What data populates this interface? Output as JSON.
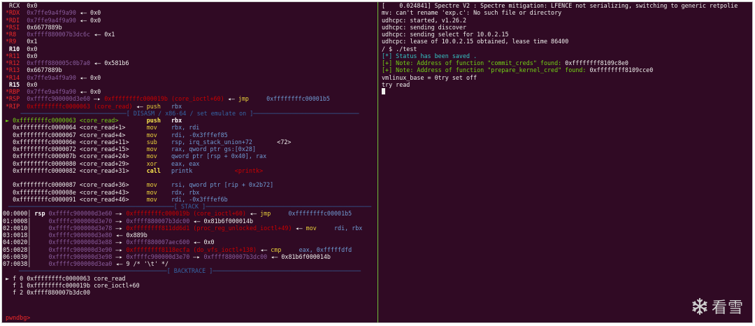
{
  "registers": [
    {
      "name": "RCX",
      "name_color": "w",
      "segs": [
        {
          "t": "0x0",
          "c": "w"
        }
      ]
    },
    {
      "name": "*RDX",
      "name_color": "r",
      "segs": [
        {
          "t": "0x7ffe9a4f9a90",
          "c": "m"
        },
        {
          "t": " ◂— ",
          "c": "w"
        },
        {
          "t": "0x0",
          "c": "w"
        }
      ]
    },
    {
      "name": "*RDI",
      "name_color": "r",
      "segs": [
        {
          "t": "0x7ffe9a4f9a90",
          "c": "m"
        },
        {
          "t": " ◂— ",
          "c": "w"
        },
        {
          "t": "0x0",
          "c": "w"
        }
      ]
    },
    {
      "name": "*RSI",
      "name_color": "r",
      "segs": [
        {
          "t": "0x6677889b",
          "c": "w"
        }
      ]
    },
    {
      "name": "*R8",
      "name_color": "r",
      "segs": [
        {
          "t": "0xffff880007b3dc6c",
          "c": "m"
        },
        {
          "t": " ◂— ",
          "c": "w"
        },
        {
          "t": "0x1",
          "c": "w"
        }
      ]
    },
    {
      "name": "*R9",
      "name_color": "r",
      "segs": [
        {
          "t": "0x1",
          "c": "w"
        }
      ]
    },
    {
      "name": "R10",
      "name_color": "b",
      "segs": [
        {
          "t": "0x0",
          "c": "w"
        }
      ]
    },
    {
      "name": "*R11",
      "name_color": "r",
      "segs": [
        {
          "t": "0x0",
          "c": "w"
        }
      ]
    },
    {
      "name": "*R12",
      "name_color": "r",
      "segs": [
        {
          "t": "0xffff880005c0b7a0",
          "c": "m"
        },
        {
          "t": " ◂— ",
          "c": "w"
        },
        {
          "t": "0x581b6",
          "c": "w"
        }
      ]
    },
    {
      "name": "*R13",
      "name_color": "r",
      "segs": [
        {
          "t": "0x6677889b",
          "c": "w"
        }
      ]
    },
    {
      "name": "*R14",
      "name_color": "r",
      "segs": [
        {
          "t": "0x7ffe9a4f9a90",
          "c": "m"
        },
        {
          "t": " ◂— ",
          "c": "w"
        },
        {
          "t": "0x0",
          "c": "w"
        }
      ]
    },
    {
      "name": "R15",
      "name_color": "b",
      "segs": [
        {
          "t": "0x0",
          "c": "w"
        }
      ]
    },
    {
      "name": "*RBP",
      "name_color": "r",
      "segs": [
        {
          "t": "0x7ffe9a4f9a90",
          "c": "m"
        },
        {
          "t": " ◂— ",
          "c": "w"
        },
        {
          "t": "0x0",
          "c": "w"
        }
      ]
    },
    {
      "name": "*RSP",
      "name_color": "r",
      "segs": [
        {
          "t": "0xffffc900000d3e60",
          "c": "m"
        },
        {
          "t": " —▸ ",
          "c": "w"
        },
        {
          "t": "0xffffffffc000019b (core_ioctl+60)",
          "c": "rd"
        },
        {
          "t": " ◂— ",
          "c": "w"
        },
        {
          "t": "jmp",
          "c": "yn"
        },
        {
          "t": "     ",
          "c": "w"
        },
        {
          "t": "0xffffffffc00001b5",
          "c": "bd"
        }
      ]
    },
    {
      "name": "*RIP",
      "name_color": "r",
      "segs": [
        {
          "t": "0xffffffffc0000063 (core_read)",
          "c": "rd"
        },
        {
          "t": " ◂— ",
          "c": "w"
        },
        {
          "t": "push",
          "c": "yn"
        },
        {
          "t": "   rbx",
          "c": "bl"
        }
      ]
    }
  ],
  "disasm_banner": "[ DISASM / x86-64 / set emulate on ]",
  "disasm": [
    {
      "cur": true,
      "addr": "0xffffffffc0000063 <core_read>",
      "mn": "push",
      "op": "rbx",
      "hl": true
    },
    {
      "addr": "0xffffffffc0000064 <core_read+1>",
      "mn": "mov",
      "op": "rbx, rdi"
    },
    {
      "addr": "0xffffffffc0000067 <core_read+4>",
      "mn": "mov",
      "op": "rdi, -0x3fffef85"
    },
    {
      "addr": "0xffffffffc000006e <core_read+11>",
      "mn": "sub",
      "op": "rsp, irq_stack_union+72",
      "extra": "<72>"
    },
    {
      "addr": "0xffffffffc0000072 <core_read+15>",
      "mn": "mov",
      "op": "rax, qword ptr gs:[0x28]"
    },
    {
      "addr": "0xffffffffc000007b <core_read+24>",
      "mn": "mov",
      "op": "qword ptr [rsp + 0x40], rax"
    },
    {
      "addr": "0xffffffffc0000080 <core_read+29>",
      "mn": "xor",
      "op": "eax, eax"
    },
    {
      "addr": "0xffffffffc0000082 <core_read+31>",
      "mn": "call",
      "op": "printk",
      "extra": "<printk>",
      "call": true
    },
    {
      "blank": true
    },
    {
      "addr": "0xffffffffc0000087 <core_read+36>",
      "mn": "mov",
      "op": "rsi, qword ptr [rip + 0x2b72]"
    },
    {
      "addr": "0xffffffffc000008e <core_read+43>",
      "mn": "mov",
      "op": "rdx, rbx"
    },
    {
      "addr": "0xffffffffc0000091 <core_read+46>",
      "mn": "mov",
      "op": "rdi, -0x3fffef6b"
    }
  ],
  "stack_banner": "[ STACK ]",
  "stack": [
    {
      "idx": "00:0000",
      "lbl": "rsp",
      "segs": [
        {
          "t": "0xffffc900000d3e60",
          "c": "m"
        },
        {
          "t": " —▸ ",
          "c": "w"
        },
        {
          "t": "0xffffffffc000019b (core_ioctl+60)",
          "c": "rd"
        },
        {
          "t": " ◂— ",
          "c": "w"
        },
        {
          "t": "jmp",
          "c": "yn"
        },
        {
          "t": "     0xffffffffc00001b5",
          "c": "bd"
        }
      ]
    },
    {
      "idx": "01:0008",
      "lbl": "",
      "segs": [
        {
          "t": "0xffffc900000d3e70",
          "c": "m"
        },
        {
          "t": " —▸ ",
          "c": "w"
        },
        {
          "t": "0xffff880007b3dc00",
          "c": "m"
        },
        {
          "t": " ◂— ",
          "c": "w"
        },
        {
          "t": "0x81b6f000014b",
          "c": "w"
        }
      ]
    },
    {
      "idx": "02:0010",
      "lbl": "",
      "segs": [
        {
          "t": "0xffffc900000d3e78",
          "c": "m"
        },
        {
          "t": " —▸ ",
          "c": "w"
        },
        {
          "t": "0xffffffff811dd6d1 (proc_reg_unlocked_ioctl+49)",
          "c": "rd"
        },
        {
          "t": " ◂— ",
          "c": "w"
        },
        {
          "t": "mov",
          "c": "yn"
        },
        {
          "t": "     rdi, rbx",
          "c": "bd"
        }
      ]
    },
    {
      "idx": "03:0018",
      "lbl": "",
      "segs": [
        {
          "t": "0xffffc900000d3e80",
          "c": "m"
        },
        {
          "t": " ◂— ",
          "c": "w"
        },
        {
          "t": "0x889b",
          "c": "w"
        }
      ]
    },
    {
      "idx": "04:0020",
      "lbl": "",
      "segs": [
        {
          "t": "0xffffc900000d3e88",
          "c": "m"
        },
        {
          "t": " —▸ ",
          "c": "w"
        },
        {
          "t": "0xffff880007aec600",
          "c": "m"
        },
        {
          "t": " ◂— ",
          "c": "w"
        },
        {
          "t": "0x0",
          "c": "w"
        }
      ]
    },
    {
      "idx": "05:0028",
      "lbl": "",
      "segs": [
        {
          "t": "0xffffc900000d3e90",
          "c": "m"
        },
        {
          "t": " —▸ ",
          "c": "w"
        },
        {
          "t": "0xffffffff8118ecfa (do_vfs_ioctl+138)",
          "c": "rd"
        },
        {
          "t": " ◂— ",
          "c": "w"
        },
        {
          "t": "cmp",
          "c": "yn"
        },
        {
          "t": "     eax, 0xfffffdfd",
          "c": "bd"
        }
      ]
    },
    {
      "idx": "06:0030",
      "lbl": "",
      "segs": [
        {
          "t": "0xffffc900000d3e98",
          "c": "m"
        },
        {
          "t": " —▸ ",
          "c": "w"
        },
        {
          "t": "0xffffc900000d3e70",
          "c": "m"
        },
        {
          "t": " —▸ ",
          "c": "w"
        },
        {
          "t": "0xffff880007b3dc00",
          "c": "m"
        },
        {
          "t": " ◂— ",
          "c": "w"
        },
        {
          "t": "0x81b6f000014b",
          "c": "w"
        }
      ]
    },
    {
      "idx": "07:0038",
      "lbl": "",
      "segs": [
        {
          "t": "0xffffc900000d3ea0",
          "c": "m"
        },
        {
          "t": " ◂— ",
          "c": "w"
        },
        {
          "t": "9 /* '\\t' */",
          "c": "w"
        }
      ]
    }
  ],
  "backtrace_banner": "[ BACKTRACE ]",
  "backtrace": [
    {
      "cur": true,
      "text": "f 0 0xffffffffc0000063 core_read"
    },
    {
      "text": "f 1 0xffffffffc000019b core_ioctl+60"
    },
    {
      "text": "f 2 0xffff880007b3dc00"
    }
  ],
  "prompt": "pwndbg>",
  "console": [
    {
      "segs": [
        {
          "t": "[    0.024841] Spectre V2 : Spectre mitigation: LFENCE not serializing, switching to generic retpolie",
          "c": "w"
        }
      ]
    },
    {
      "segs": [
        {
          "t": "mv: can't rename 'exp.c': No such file or directory",
          "c": "w"
        }
      ]
    },
    {
      "segs": [
        {
          "t": "udhcpc: started, v1.26.2",
          "c": "w"
        }
      ]
    },
    {
      "segs": [
        {
          "t": "udhcpc: sending discover",
          "c": "w"
        }
      ]
    },
    {
      "segs": [
        {
          "t": "udhcpc: sending select for 10.0.2.15",
          "c": "w"
        }
      ]
    },
    {
      "segs": [
        {
          "t": "udhcpc: lease of 10.0.2.15 obtained, lease time 86400",
          "c": "w"
        }
      ]
    },
    {
      "segs": [
        {
          "t": "/ $ ./test",
          "c": "w"
        }
      ]
    },
    {
      "segs": [
        {
          "t": "[*] Status has been saved .",
          "c": "c"
        }
      ]
    },
    {
      "segs": [
        {
          "t": "[+] Note: Address of function \"commit_creds\" found: ",
          "c": "gr"
        },
        {
          "t": "0xffffffff8109c8e0",
          "c": "w"
        }
      ]
    },
    {
      "segs": [
        {
          "t": "[+] Note: Address of function \"prepare_kernel_cred\" found: ",
          "c": "gr"
        },
        {
          "t": "0xffffffff8109cce0",
          "c": "w"
        }
      ]
    },
    {
      "segs": [
        {
          "t": "vmlinux_base = 0try set off",
          "c": "w"
        }
      ]
    },
    {
      "segs": [
        {
          "t": "try read",
          "c": "w"
        }
      ]
    }
  ],
  "watermark": "看雪",
  "watermark_icon": "snowflake-icon"
}
